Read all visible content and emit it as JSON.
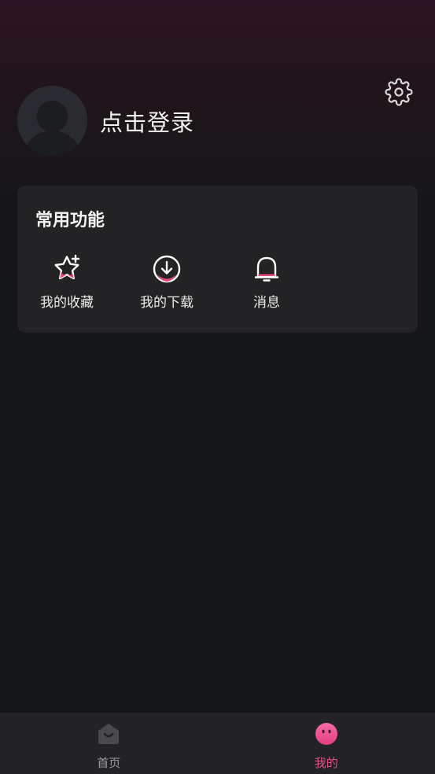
{
  "profile": {
    "login_text": "点击登录"
  },
  "common_functions": {
    "title": "常用功能",
    "items": [
      {
        "label": "我的收藏",
        "icon": "star-add-icon"
      },
      {
        "label": "我的下载",
        "icon": "download-icon"
      },
      {
        "label": "消息",
        "icon": "bell-icon"
      }
    ]
  },
  "tabbar": {
    "items": [
      {
        "label": "首页",
        "icon": "home-icon",
        "active": false
      },
      {
        "label": "我的",
        "icon": "face-icon",
        "active": true
      }
    ]
  },
  "colors": {
    "accent": "#ea4c8e",
    "background": "#151618",
    "card": "#232325"
  }
}
